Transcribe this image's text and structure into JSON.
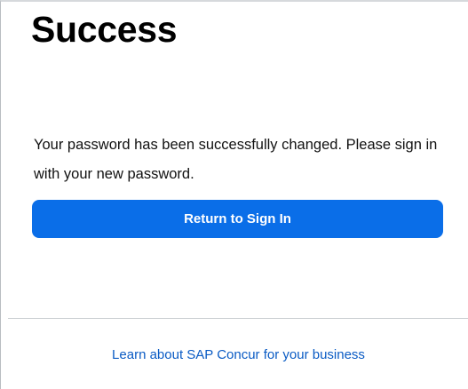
{
  "page": {
    "title": "Success",
    "message": "Your password has been successfully changed. Please sign in with your new password."
  },
  "actions": {
    "return_label": "Return to Sign In"
  },
  "footer": {
    "link_label": "Learn about SAP Concur for your business"
  },
  "colors": {
    "primary_button": "#0a6ee8",
    "link": "#0a5bc4"
  }
}
